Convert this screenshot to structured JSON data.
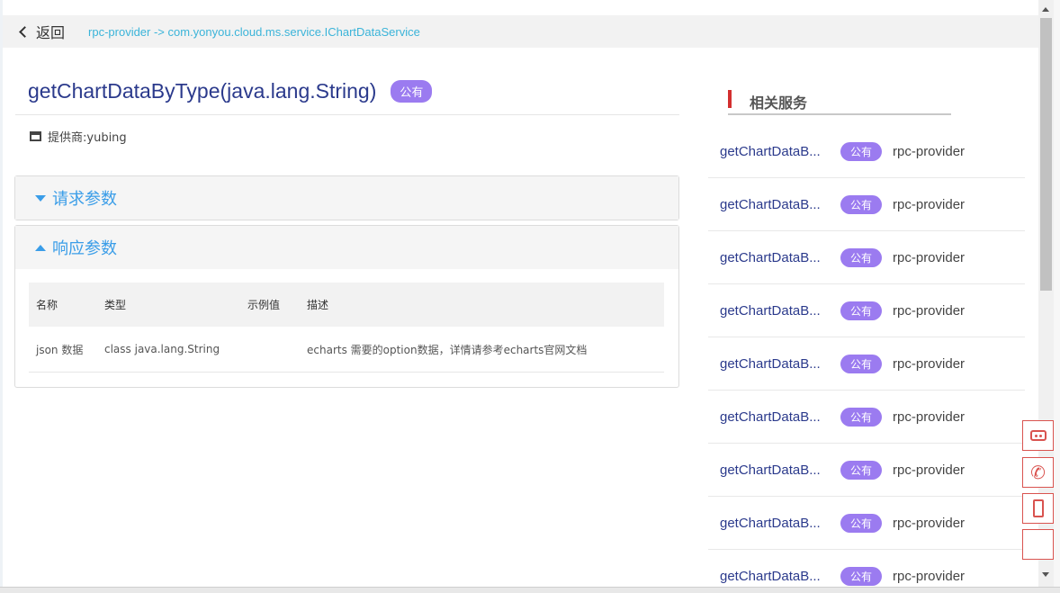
{
  "header": {
    "back_label": "返回",
    "breadcrumb": "rpc-provider -> com.yonyou.cloud.ms.service.IChartDataService"
  },
  "method": {
    "title": "getChartDataByType(java.lang.String)",
    "badge": "公有",
    "provider": "提供商:yubing"
  },
  "request_section": {
    "label": "请求参数",
    "expanded": false
  },
  "response_section": {
    "label": "响应参数",
    "expanded": true,
    "columns": [
      "名称",
      "类型",
      "示例值",
      "描述"
    ],
    "rows": [
      [
        "json 数据",
        "class java.lang.String",
        "",
        "echarts 需要的option数据，详情请参考echarts官网文档"
      ]
    ]
  },
  "related": {
    "title": "相关服务",
    "items": [
      {
        "name": "getChartDataB...",
        "badge": "公有",
        "provider": "rpc-provider"
      },
      {
        "name": "getChartDataB...",
        "badge": "公有",
        "provider": "rpc-provider"
      },
      {
        "name": "getChartDataB...",
        "badge": "公有",
        "provider": "rpc-provider"
      },
      {
        "name": "getChartDataB...",
        "badge": "公有",
        "provider": "rpc-provider"
      },
      {
        "name": "getChartDataB...",
        "badge": "公有",
        "provider": "rpc-provider"
      },
      {
        "name": "getChartDataB...",
        "badge": "公有",
        "provider": "rpc-provider"
      },
      {
        "name": "getChartDataB...",
        "badge": "公有",
        "provider": "rpc-provider"
      },
      {
        "name": "getChartDataB...",
        "badge": "公有",
        "provider": "rpc-provider"
      },
      {
        "name": "getChartDataB...",
        "badge": "公有",
        "provider": "rpc-provider"
      }
    ]
  },
  "floating_buttons": [
    "robot-icon",
    "phone-icon",
    "mobile-icon",
    "blank"
  ],
  "colors": {
    "accent_blue": "#3a9de8",
    "title_navy": "#2b3a8c",
    "badge_purple": "#9b7bf0",
    "breadcrumb_cyan": "#3bb4d9",
    "red_accent": "#d32f2f"
  }
}
